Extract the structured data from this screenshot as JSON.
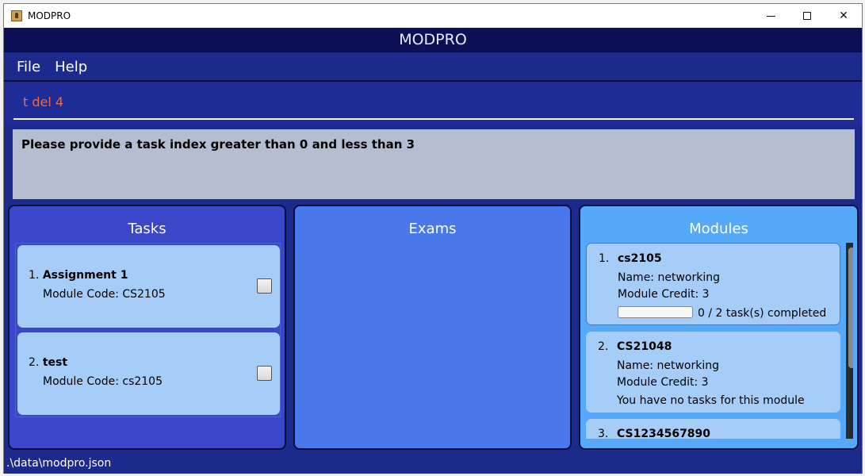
{
  "window": {
    "title": "MODPRO",
    "controls": {
      "minimize": "",
      "maximize": "",
      "close": "✕"
    }
  },
  "app": {
    "header": "MODPRO"
  },
  "menu": {
    "items": [
      "File",
      "Help"
    ]
  },
  "command": {
    "value": "t del 4"
  },
  "result": {
    "message": "Please provide a task index greater than 0 and less than 3"
  },
  "panels": {
    "tasks": {
      "title": "Tasks",
      "items": [
        {
          "index": "1.",
          "title": "Assignment 1",
          "module_code": "Module Code: CS2105",
          "done": false
        },
        {
          "index": "2.",
          "title": "test",
          "module_code": "Module Code: cs2105",
          "done": false
        }
      ]
    },
    "exams": {
      "title": "Exams"
    },
    "modules": {
      "title": "Modules",
      "items": [
        {
          "index": "1.",
          "code": "cs2105",
          "name": "Name: networking",
          "credit": "Module Credit: 3",
          "progress": 0,
          "progress_text": "0 / 2 task(s) completed"
        },
        {
          "index": "2.",
          "code": "CS21048",
          "name": "Name: networking",
          "credit": "Module Credit: 3",
          "status_text": "You have no tasks for this module"
        },
        {
          "index": "3.",
          "code": "CS1234567890"
        }
      ]
    }
  },
  "statusbar": {
    "path": ".\\data\\modpro.json"
  },
  "colors": {
    "header_bg": "#0c1156",
    "window_bg": "#1c2a8c",
    "command_text": "#e86c50",
    "result_bg": "#b4bed0",
    "tasks_panel": "#3a48c8",
    "exams_panel": "#4a78ea",
    "modules_panel": "#56a8f8",
    "card_bg": "#a6cdf8"
  }
}
